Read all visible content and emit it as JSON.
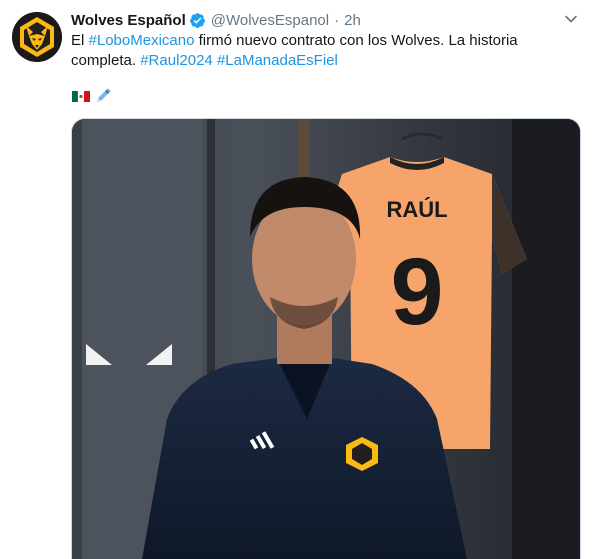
{
  "tweet": {
    "display_name": "Wolves Español",
    "handle": "@WolvesEspanol",
    "separator": "·",
    "time": "2h",
    "text_parts": [
      {
        "text": "El ",
        "type": "plain"
      },
      {
        "text": "#LoboMexicano",
        "type": "tag"
      },
      {
        "text": " firmó nuevo contrato con los Wolves. La historia completa. ",
        "type": "plain"
      },
      {
        "text": "#Raul2024",
        "type": "tag"
      },
      {
        "text": " ",
        "type": "plain"
      },
      {
        "text": "#LaManadaEsFiel",
        "type": "tag"
      }
    ],
    "emojis": [
      "mexico-flag-icon",
      "pen-icon"
    ]
  },
  "image": {
    "shirt_name": "RAÚL",
    "shirt_number": "9"
  },
  "colors": {
    "link": "#1b95e0",
    "verified": "#1da1f2",
    "wolves_gold": "#fdb913",
    "shirt_orange": "#f7a46b",
    "muted": "#657786"
  }
}
